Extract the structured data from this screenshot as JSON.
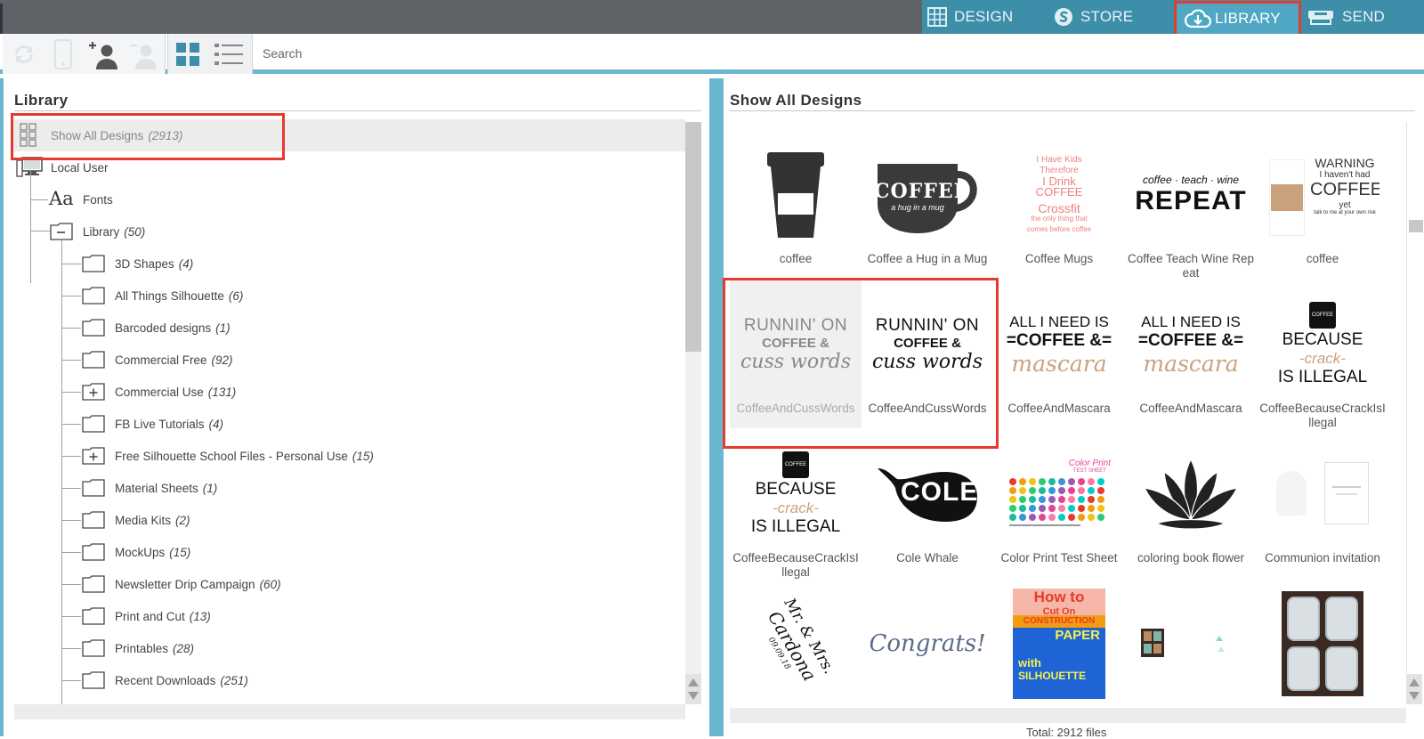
{
  "nav": {
    "tabs": [
      {
        "label": "DESIGN",
        "icon": "grid-icon"
      },
      {
        "label": "STORE",
        "icon": "store-s-icon"
      },
      {
        "label": "LIBRARY",
        "icon": "cloud-download-icon",
        "active": true
      },
      {
        "label": "SEND",
        "icon": "cutter-icon"
      }
    ]
  },
  "toolbar": {
    "search_placeholder": "Search"
  },
  "left_panel": {
    "title": "Library",
    "show_all": {
      "label": "Show All Designs",
      "count": "(2913)"
    },
    "local_user": "Local User",
    "fonts": "Fonts",
    "library": {
      "label": "Library",
      "count": "(50)"
    },
    "folders": [
      {
        "label": "3D Shapes",
        "count": "(4)",
        "expandable": false
      },
      {
        "label": "All Things Silhouette",
        "count": "(6)",
        "expandable": false
      },
      {
        "label": "Barcoded designs",
        "count": "(1)",
        "expandable": false
      },
      {
        "label": "Commercial Free",
        "count": "(92)",
        "expandable": false
      },
      {
        "label": "Commercial Use",
        "count": "(131)",
        "expandable": true
      },
      {
        "label": "FB Live Tutorials",
        "count": "(4)",
        "expandable": false
      },
      {
        "label": "Free Silhouette School Files - Personal Use",
        "count": "(15)",
        "expandable": true
      },
      {
        "label": "Material Sheets",
        "count": "(1)",
        "expandable": false
      },
      {
        "label": "Media Kits",
        "count": "(2)",
        "expandable": false
      },
      {
        "label": "MockUps",
        "count": "(15)",
        "expandable": false
      },
      {
        "label": "Newsletter Drip Campaign",
        "count": "(60)",
        "expandable": false
      },
      {
        "label": "Print and Cut",
        "count": "(13)",
        "expandable": false
      },
      {
        "label": "Printables",
        "count": "(28)",
        "expandable": false
      },
      {
        "label": "Recent Downloads",
        "count": "(251)",
        "expandable": false
      }
    ]
  },
  "right_panel": {
    "title": "Show All Designs",
    "footer": "Total: 2912 files",
    "designs": [
      {
        "label": "coffee",
        "thumb": "coffee-cup"
      },
      {
        "label": "Coffee a Hug in a Mug",
        "thumb": "coffee-mug"
      },
      {
        "label": "Coffee Mugs",
        "thumb": "coffee-mugs-text"
      },
      {
        "label": "Coffee Teach Wine Repeat",
        "thumb": "repeat"
      },
      {
        "label": "coffee",
        "thumb": "warning"
      },
      {
        "label": "CoffeeAndCussWords",
        "thumb": "cuss-gray",
        "selected": true
      },
      {
        "label": "CoffeeAndCussWords",
        "thumb": "cuss"
      },
      {
        "label": "CoffeeAndMascara",
        "thumb": "mascara"
      },
      {
        "label": "CoffeeAndMascara",
        "thumb": "mascara"
      },
      {
        "label": "CoffeeBecauseCrackIsIllegal",
        "thumb": "crack"
      },
      {
        "label": "CoffeeBecauseCrackIsIllegal",
        "thumb": "crack"
      },
      {
        "label": "Cole Whale",
        "thumb": "whale"
      },
      {
        "label": "Color Print Test Sheet",
        "thumb": "color-test"
      },
      {
        "label": "coloring book flower",
        "thumb": "lotus"
      },
      {
        "label": "Communion invitation",
        "thumb": "communion"
      },
      {
        "label": "",
        "thumb": "mr-mrs"
      },
      {
        "label": "",
        "thumb": "congrats"
      },
      {
        "label": "",
        "thumb": "construction"
      },
      {
        "label": "",
        "thumb": "squares"
      },
      {
        "label": "",
        "thumb": "photo-tiles"
      }
    ],
    "thumb_text": {
      "coffee_mug": "COFFEE",
      "coffee_mug_sub": "a hug in a mug",
      "mugs_1": "I Have Kids",
      "mugs_2": "Therefore",
      "mugs_3": "I Drink",
      "mugs_4": "COFFEE",
      "mugs_5": "Crossfit",
      "mugs_6": "the only thing that",
      "mugs_7": "comes before coffee",
      "repeat_top": "coffee · teach · wine",
      "repeat_main": "REPEAT",
      "warn_1": "WARNING",
      "warn_2": "I haven't had",
      "warn_3": "COFFEE",
      "warn_4": "yet",
      "warn_5": "talk to me at your own risk",
      "cuss_1": "RUNNIN' ON",
      "cuss_2": "COFFEE &",
      "cuss_3": "cuss words",
      "masc_1": "ALL I NEED IS",
      "masc_2": "=COFFEE &=",
      "masc_3": "mascara",
      "crack_cup": "COFFEE",
      "crack_1": "BECAUSE",
      "crack_2": "-crack-",
      "crack_3": "IS ILLEGAL",
      "whale": "COLE",
      "color_title": "Color Print",
      "color_sub": "TEST SHEET",
      "mrmrs_1": "Mr. & Mrs.",
      "mrmrs_2": "Cardona",
      "mrmrs_3": "09.09.18",
      "congrats": "Congrats!",
      "cons_1": "How to",
      "cons_2": "Cut On",
      "cons_3": "CONSTRUCTION",
      "cons_4": "PAPER",
      "cons_5": "with",
      "cons_6": "SILHOUETTE"
    }
  }
}
